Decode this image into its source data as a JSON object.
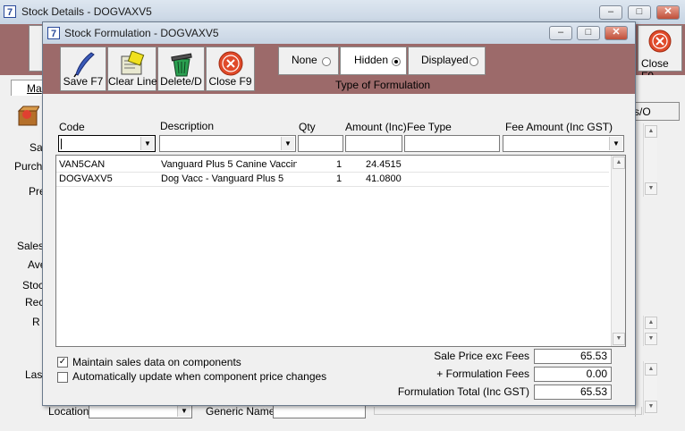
{
  "back_window": {
    "title": "Stock Details - DOGVAXV5",
    "close_label": "Close F9",
    "tab_label": "Ma",
    "side_labels": [
      "Sa",
      "Purch",
      "Pre",
      "Sales",
      "Ave",
      "Stoc",
      "Rec",
      "R",
      "Last"
    ],
    "right_button_label": "s/O",
    "location_label": "Location",
    "generic_name_label": "Generic Name"
  },
  "dialog": {
    "title": "Stock Formulation - DOGVAXV5",
    "toolbar": {
      "save_label": "Save F7",
      "clear_label": "Clear Line",
      "delete_label": "Delete/D",
      "close_label": "Close F9"
    },
    "formulation_type": {
      "caption": "Type of Formulation",
      "options": [
        "None",
        "Hidden",
        "Displayed"
      ],
      "selected": "Hidden"
    },
    "columns": {
      "code": "Code",
      "description": "Description",
      "qty": "Qty",
      "amount": "Amount (Inc)",
      "fee_type": "Fee Type",
      "fee_amount": "Fee Amount (Inc GST)"
    },
    "rows": [
      {
        "code": "VAN5CAN",
        "description": "Vanguard Plus 5 Canine Vaccin",
        "qty": "1",
        "amount": "24.4515"
      },
      {
        "code": "DOGVAXV5",
        "description": "Dog Vacc - Vanguard Plus 5",
        "qty": "1",
        "amount": "41.0800"
      }
    ],
    "options": {
      "maintain_sales_label": "Maintain sales data on components",
      "maintain_sales_checked": true,
      "auto_update_label": "Automatically update when component price changes",
      "auto_update_checked": false
    },
    "totals": {
      "sale_price_label": "Sale Price exc Fees",
      "sale_price_value": "65.53",
      "formulation_fees_label": "+ Formulation Fees",
      "formulation_fees_value": "0.00",
      "formulation_total_label": "Formulation Total (Inc GST)",
      "formulation_total_value": "65.53"
    }
  },
  "colors": {
    "toolbar_band": "#9c6a6a",
    "title_gradient": "#c7d4e3",
    "close_icon": "#e04a2a"
  }
}
